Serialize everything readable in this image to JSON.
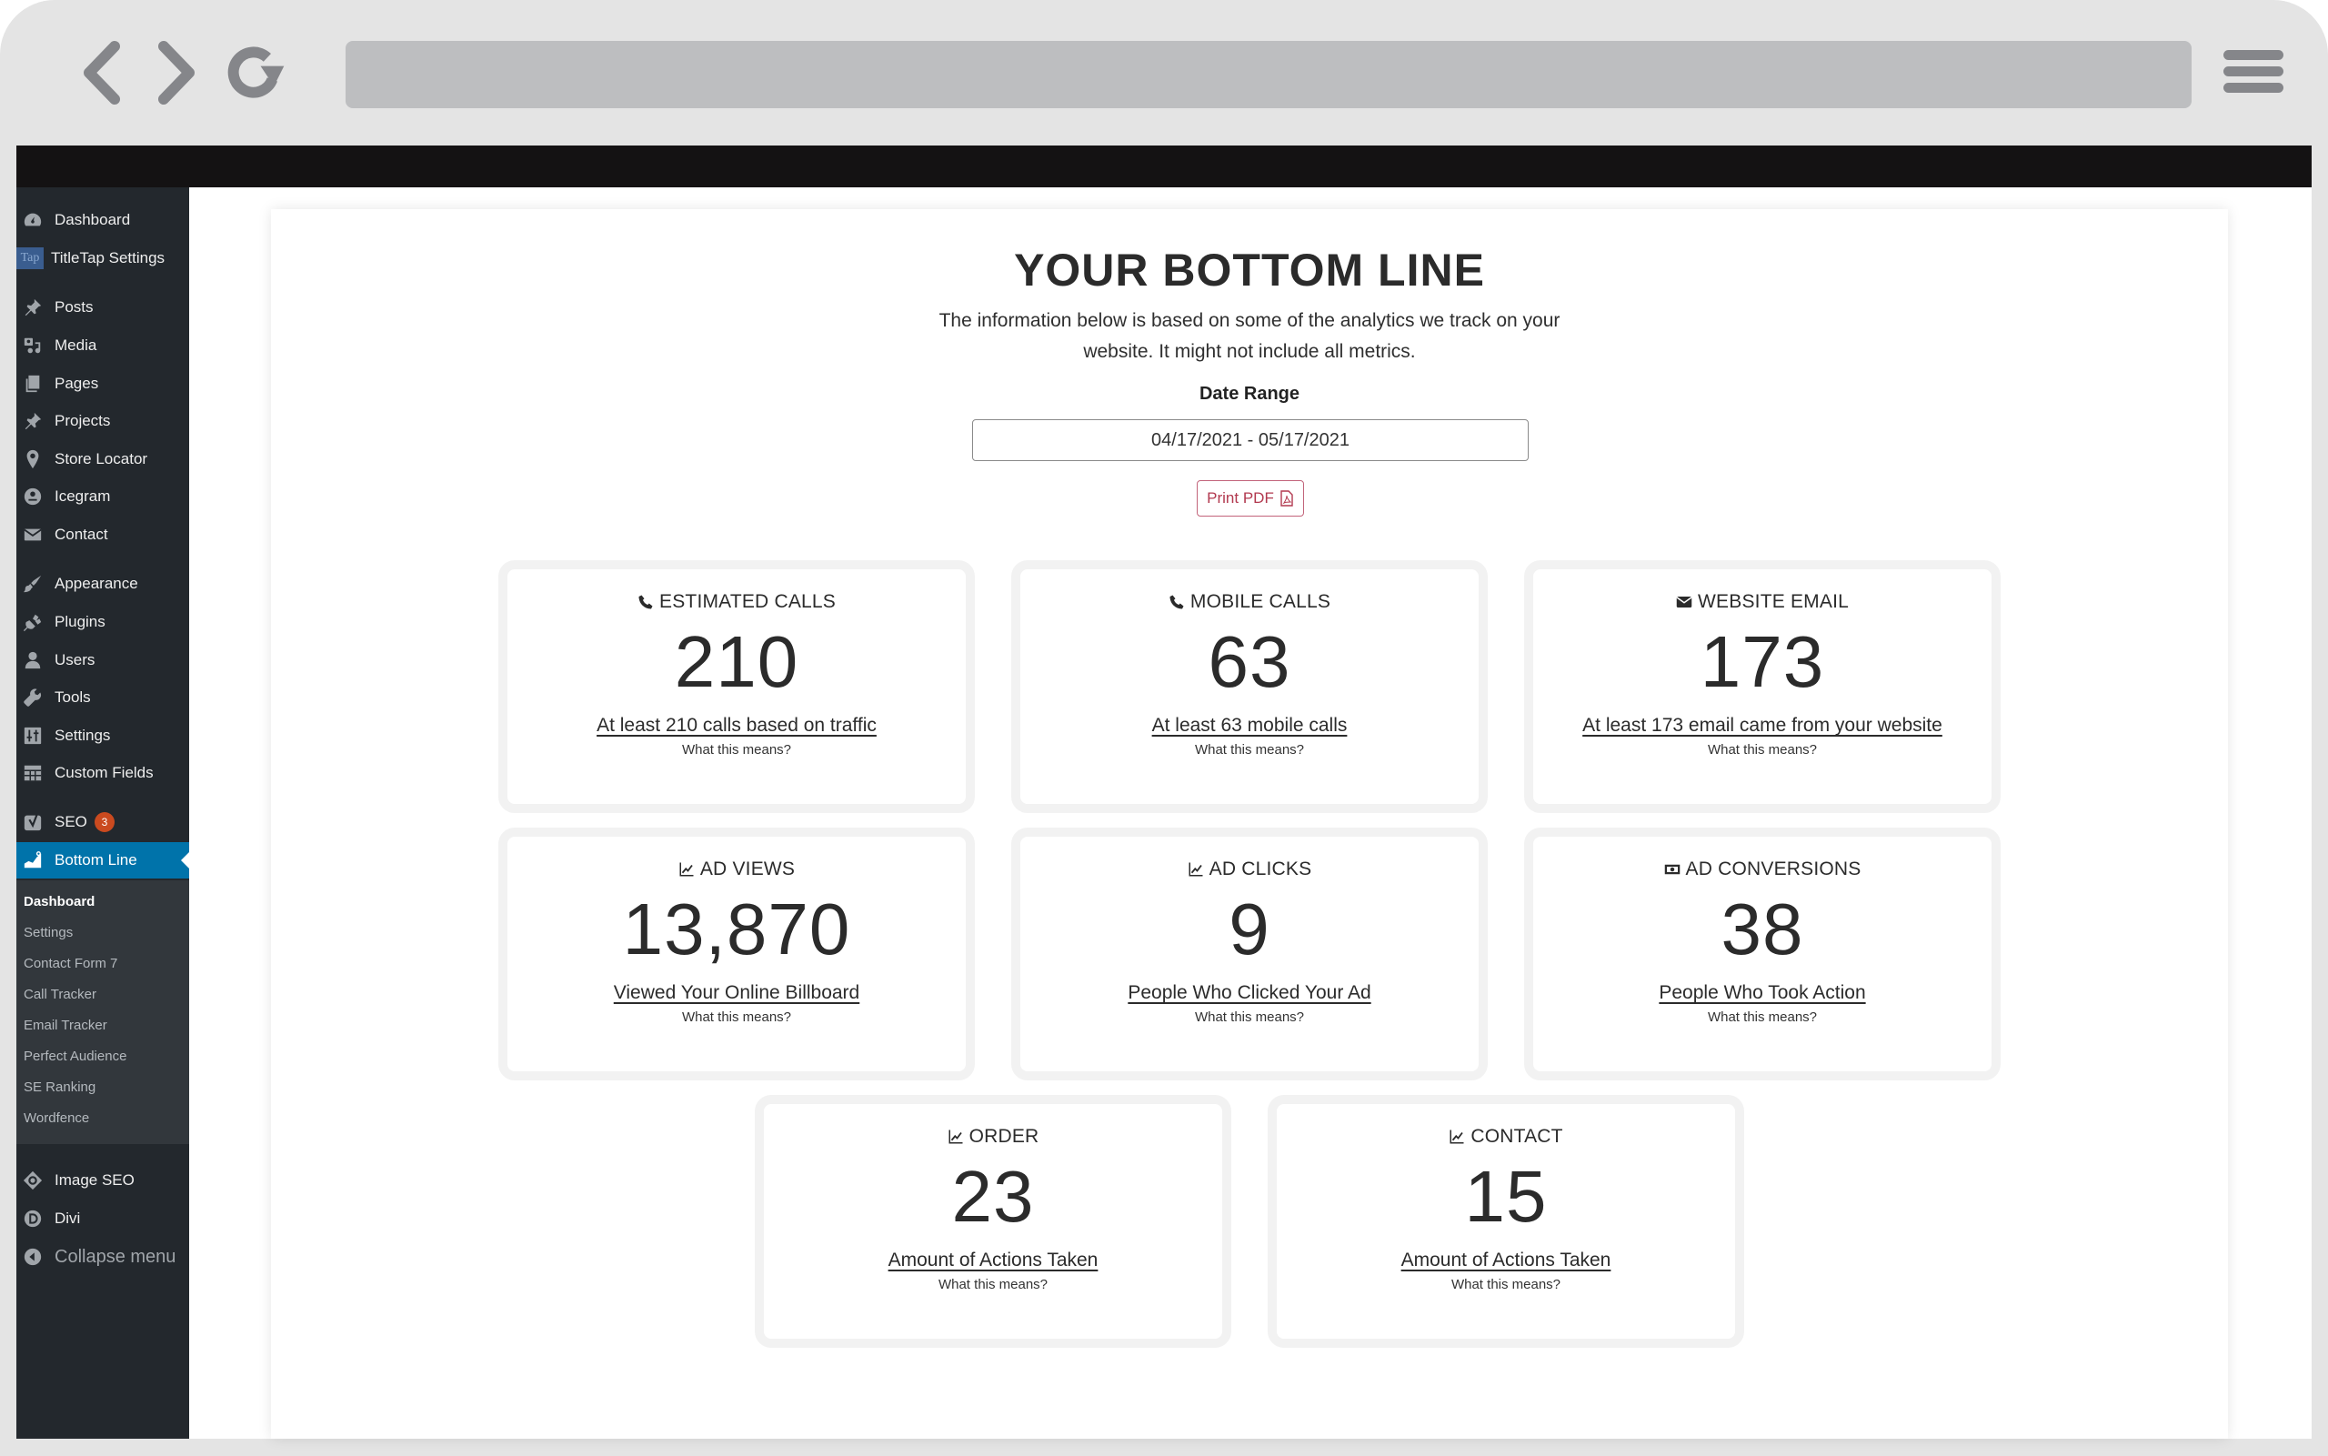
{
  "browser": {
    "back_icon": "chevron-left-icon",
    "forward_icon": "chevron-right-icon",
    "reload_icon": "reload-icon",
    "menu_icon": "hamburger-icon",
    "address": ""
  },
  "sidebar": {
    "items": [
      {
        "label": "Dashboard",
        "icon": "dashboard-gauge-icon"
      },
      {
        "label": "TitleTap Settings",
        "icon": "titletap-logo",
        "logo_text": "Tap"
      },
      {
        "label": "Posts",
        "icon": "pushpin-icon"
      },
      {
        "label": "Media",
        "icon": "media-icon"
      },
      {
        "label": "Pages",
        "icon": "pages-icon"
      },
      {
        "label": "Projects",
        "icon": "pushpin-icon"
      },
      {
        "label": "Store Locator",
        "icon": "location-pin-icon"
      },
      {
        "label": "Icegram",
        "icon": "icegram-icon"
      },
      {
        "label": "Contact",
        "icon": "envelope-icon"
      },
      {
        "label": "Appearance",
        "icon": "paintbrush-icon"
      },
      {
        "label": "Plugins",
        "icon": "plug-icon"
      },
      {
        "label": "Users",
        "icon": "user-icon"
      },
      {
        "label": "Tools",
        "icon": "wrench-icon"
      },
      {
        "label": "Settings",
        "icon": "sliders-icon"
      },
      {
        "label": "Custom Fields",
        "icon": "table-icon"
      },
      {
        "label": "SEO",
        "icon": "yoast-icon",
        "badge": "3"
      },
      {
        "label": "Bottom Line",
        "icon": "area-chart-icon",
        "active": true
      },
      {
        "label": "Image SEO",
        "icon": "image-seo-icon"
      },
      {
        "label": "Divi",
        "icon": "divi-icon"
      },
      {
        "label": "Collapse menu",
        "icon": "collapse-arrow-icon"
      }
    ],
    "submenu": [
      {
        "label": "Dashboard",
        "current": true
      },
      {
        "label": "Settings"
      },
      {
        "label": "Contact Form 7"
      },
      {
        "label": "Call Tracker"
      },
      {
        "label": "Email Tracker"
      },
      {
        "label": "Perfect Audience"
      },
      {
        "label": "SE Ranking"
      },
      {
        "label": "Wordfence"
      }
    ],
    "colors": {
      "background": "#23282d",
      "submenu": "#32373c",
      "active": "#0073aa",
      "badge": "#ca4a1f"
    }
  },
  "main": {
    "title": "YOUR BOTTOM LINE",
    "intro_line1": "The information below is based on some of the analytics we track on your",
    "intro_line2": "website. It might not include all metrics.",
    "date_range_label": "Date Range",
    "date_range_value": "04/17/2021 - 05/17/2021",
    "print_label": "Print PDF",
    "print_icon": "pdf-file-icon",
    "accent_color": "#b2394f",
    "cards": [
      {
        "icon": "phone-icon",
        "title": "ESTIMATED CALLS",
        "value": "210",
        "link": "At least 210 calls based on traffic",
        "help": "What this means?"
      },
      {
        "icon": "phone-icon",
        "title": "MOBILE CALLS",
        "value": "63",
        "link": "At least 63 mobile calls",
        "help": "What this means?"
      },
      {
        "icon": "envelope-icon",
        "title": "WEBSITE EMAIL",
        "value": "173",
        "link": "At least 173 email came from your website",
        "help": "What this means?"
      },
      {
        "icon": "line-chart-icon",
        "title": "AD VIEWS",
        "value": "13,870",
        "link": "Viewed Your Online Billboard",
        "help": "What this means?"
      },
      {
        "icon": "line-chart-icon",
        "title": "AD CLICKS",
        "value": "9",
        "link": "People Who Clicked Your Ad",
        "help": "What this means?"
      },
      {
        "icon": "money-bill-icon",
        "title": "AD CONVERSIONS",
        "value": "38",
        "link": "People Who Took Action",
        "help": "What this means?"
      },
      {
        "icon": "line-chart-icon",
        "title": "ORDER",
        "value": "23",
        "link": "Amount of Actions Taken",
        "help": "What this means?"
      },
      {
        "icon": "line-chart-icon",
        "title": "CONTACT",
        "value": "15",
        "link": "Amount of Actions Taken",
        "help": "What this means?"
      }
    ]
  }
}
